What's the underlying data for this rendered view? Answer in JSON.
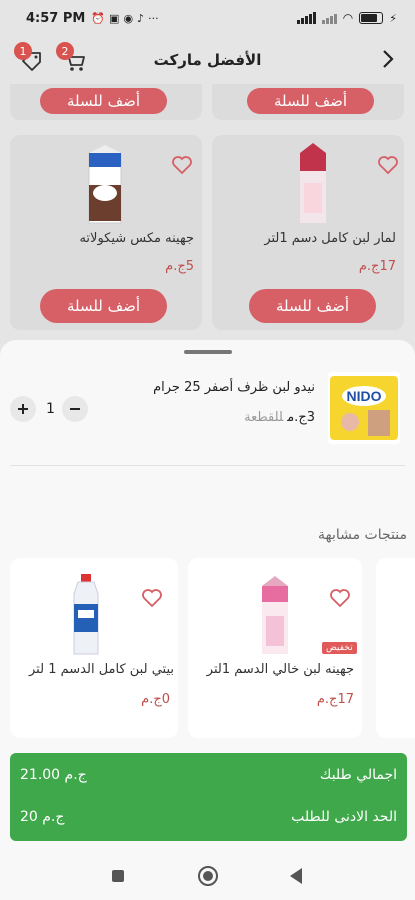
{
  "status_bar": {
    "time": "4:57 PM",
    "dots": "···"
  },
  "header": {
    "title": "الأفضل ماركت",
    "back_icon": "chevron-right-icon",
    "notif_count": "1",
    "cart_count": "2"
  },
  "grid": {
    "add_label": "أضف للسلة",
    "items": [
      {
        "name": "لمار لبن كامل دسم 1لتر",
        "price": "17ج.م"
      },
      {
        "name": "جهينه مكس شيكولاته",
        "price": "5ج.م"
      }
    ]
  },
  "cart_item": {
    "name": "نيدو لبن ظرف أصفر 25 جرام",
    "price": "3ج.م",
    "unit": "للقطعة",
    "quantity": "1",
    "img_text": "NIDO"
  },
  "similar": {
    "title": "منتجات مشابهة",
    "sale_label": "تخفيض",
    "items": [
      {
        "name": "جهينه لبن خالي الدسم 1لتر",
        "price": "17ج.م"
      },
      {
        "name": "بيتي لبن كامل الدسم 1 لتر",
        "price": "0ج.م"
      }
    ]
  },
  "summary": {
    "total_label": "اجمالي طلبك",
    "total_value": "21.00 ج.م",
    "min_label": "الحد الادنى للطلب",
    "min_value": "20 ج.م"
  },
  "colors": {
    "accent": "#d75f66",
    "summary_green": "#3ea84a",
    "price_red": "#c0504d"
  }
}
